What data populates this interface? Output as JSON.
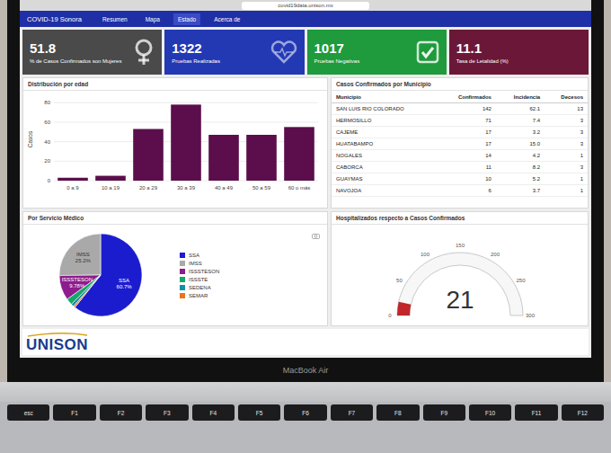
{
  "browser": {
    "url": "covid19data.unison.mx"
  },
  "app": {
    "title": "COVID-19 Sonora",
    "nav": [
      {
        "label": "Resumen",
        "selected": false
      },
      {
        "label": "Mapa",
        "selected": false
      },
      {
        "label": "Estado",
        "selected": true
      },
      {
        "label": "Acerca de",
        "selected": false
      }
    ]
  },
  "cards": [
    {
      "value": "51.8",
      "label": "% de Casos Confirmados son Mujeres",
      "color": "#4a4a4a",
      "kind": "female"
    },
    {
      "value": "1322",
      "label": "Pruebas Realizadas",
      "color": "#2339b4",
      "kind": "heart"
    },
    {
      "value": "1017",
      "label": "Pruebas Negativas",
      "color": "#1f9a3c",
      "kind": "check"
    },
    {
      "value": "11.1",
      "label": "Tasa de Letalidad (%)",
      "color": "#6b1838",
      "kind": "none"
    }
  ],
  "age_chart": {
    "title": "Distribución por edad",
    "y_label": "Casos",
    "y_ticks": [
      "0",
      "20",
      "40",
      "60",
      "80"
    ],
    "categories": [
      "0 a 9",
      "10 a 19",
      "20 a 29",
      "30 a 39",
      "40 a 49",
      "50 a 59",
      "60 o más"
    ],
    "values": [
      3,
      5,
      53,
      78,
      47,
      47,
      55
    ]
  },
  "municipios_table": {
    "title": "Casos Confirmados por Municipio",
    "columns": [
      "Municipio",
      "Confirmados",
      "Incidencia",
      "Decesos"
    ],
    "rows": [
      [
        "SAN LUIS RIO COLORADO",
        "142",
        "62.1",
        "13"
      ],
      [
        "HERMOSILLO",
        "71",
        "7.4",
        "3"
      ],
      [
        "CAJEME",
        "17",
        "3.2",
        "3"
      ],
      [
        "HUATABAMPO",
        "17",
        "15.0",
        "3"
      ],
      [
        "NOGALES",
        "14",
        "4.2",
        "1"
      ],
      [
        "CABORCA",
        "11",
        "8.2",
        "3"
      ],
      [
        "GUAYMAS",
        "10",
        "5.2",
        "1"
      ],
      [
        "NAVOJOA",
        "6",
        "3.7",
        "1"
      ]
    ]
  },
  "service_chart": {
    "title": "Por Servicio Médico",
    "slices": [
      {
        "name": "SSA",
        "value": 60.7,
        "label_lines": [
          "SSA",
          "60.7%"
        ],
        "color": "#1c1ccf"
      },
      {
        "name": "IMSS",
        "value": 25.2,
        "label_lines": [
          "IMSS",
          "25.2%"
        ],
        "color": "#a9a9a9"
      },
      {
        "name": "ISSSTESON",
        "value": 9.78,
        "label_lines": [
          "ISSSTESON",
          "9.78%"
        ],
        "color": "#8e1c8e"
      },
      {
        "name": "ISSSTE",
        "value": 2.5,
        "label_lines": [],
        "color": "#16a86a"
      },
      {
        "name": "SEDENA",
        "value": 1.2,
        "label_lines": [],
        "color": "#178fa6"
      },
      {
        "name": "SEMAR",
        "value": 0.62,
        "label_lines": [],
        "color": "#e8741e"
      }
    ]
  },
  "gauge": {
    "title": "Hospitalizados respecto a Casos Confirmados",
    "display": "21",
    "level": 0.07,
    "ticks": [
      "0",
      "50",
      "100",
      "150",
      "200",
      "250",
      "300"
    ]
  },
  "logo": "UNISON",
  "laptop": {
    "brand": "MacBook Air",
    "keys": [
      "esc",
      "F1",
      "F2",
      "F3",
      "F4",
      "F5",
      "F6",
      "F7",
      "F8",
      "F9",
      "F10",
      "F11",
      "F12"
    ]
  }
}
